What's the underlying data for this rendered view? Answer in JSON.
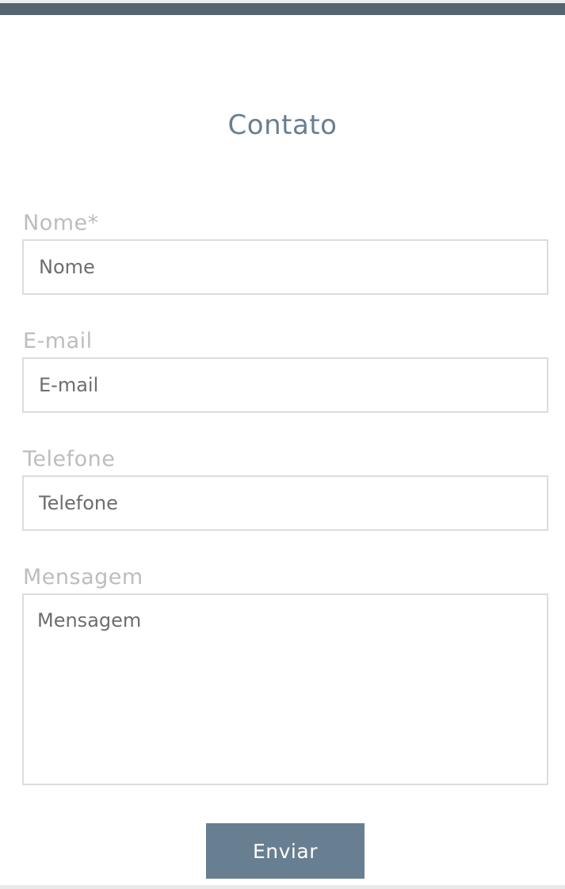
{
  "form": {
    "title": "Contato",
    "fields": [
      {
        "label": "Nome*",
        "placeholder": "Nome"
      },
      {
        "label": "E-mail",
        "placeholder": "E-mail"
      },
      {
        "label": "Telefone",
        "placeholder": "Telefone"
      },
      {
        "label": "Mensagem",
        "placeholder": "Mensagem"
      }
    ],
    "submit_label": "Enviar"
  },
  "colors": {
    "accent": "#687f91",
    "top_bar": "#56646f",
    "label": "#bdbdbd",
    "border": "#dcdcdc"
  }
}
